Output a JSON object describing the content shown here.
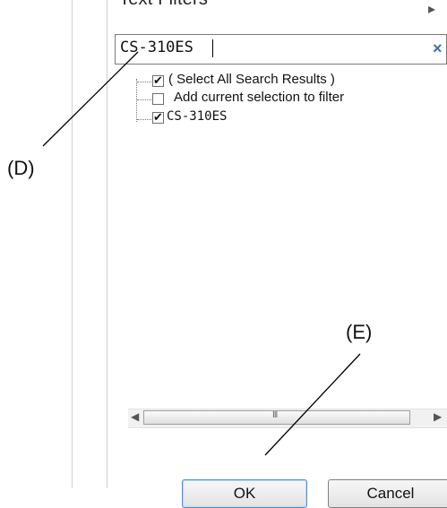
{
  "header": {
    "title": "Text Filters",
    "mnemonic": "F"
  },
  "search": {
    "value": "CS-310ES",
    "clear_icon": "clear-x-icon"
  },
  "tree": {
    "items": [
      {
        "label": "( Select All Search Results )",
        "checked": true
      },
      {
        "label": "Add current selection to filter",
        "checked": false
      },
      {
        "label": "CS-310ES",
        "checked": true
      }
    ]
  },
  "scrollbar": {
    "left_arrow": "◀",
    "right_arrow": "▶",
    "grip": "III"
  },
  "buttons": {
    "ok_label": "OK",
    "cancel_label": "Cancel"
  },
  "callouts": {
    "d_label": "(D)",
    "e_label": "(E)"
  },
  "colors": {
    "accent_clear": "#3a6fb0",
    "ok_border": "#4a90d6"
  }
}
